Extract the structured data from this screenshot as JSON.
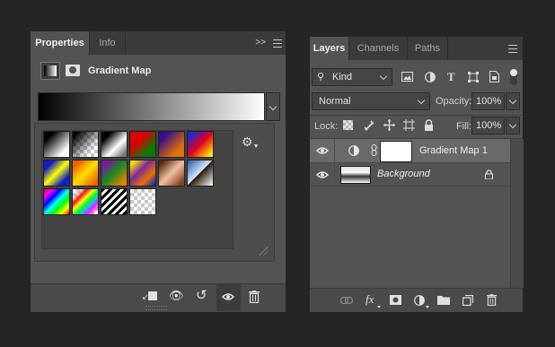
{
  "properties": {
    "tabs": [
      {
        "label": "Properties"
      },
      {
        "label": "Info"
      }
    ],
    "expand_label": ">>",
    "title": "Gradient Map",
    "icons": [
      "adjustment-layer-icon",
      "layer-mask-icon",
      "gear-icon",
      "clip-to-layer-icon",
      "view-previous-state-icon",
      "reset-icon",
      "visibility-icon",
      "trash-icon"
    ],
    "preset_gradients": [
      "black-white",
      "black-transparent",
      "black-white-2",
      "red-green",
      "violet-orange",
      "blue-red-yellow",
      "blue-yellow-blue",
      "orange-yellow-orange",
      "violet-green-orange",
      "yellow-violet-orange-blue",
      "copper",
      "chrome",
      "spectrum",
      "transparent-rainbow",
      "transparent-stripes",
      "checker"
    ]
  },
  "layers": {
    "tabs": [
      {
        "label": "Layers"
      },
      {
        "label": "Channels"
      },
      {
        "label": "Paths"
      }
    ],
    "filter": {
      "kind_label": "Kind"
    },
    "blend_mode": "Normal",
    "opacity_label": "Opacity:",
    "opacity_value": "100%",
    "lock_label": "Lock:",
    "fill_label": "Fill:",
    "fill_value": "100%",
    "items": [
      {
        "name": "Gradient Map 1",
        "selected": true
      },
      {
        "name": "Background",
        "selected": false
      }
    ],
    "footer_icons": [
      "link-icon",
      "fx-icon",
      "mask-icon",
      "adjustment-icon",
      "folder-icon",
      "new-layer-icon",
      "trash-icon"
    ],
    "fx_label": "fx"
  },
  "colors": {
    "panel": "#535353",
    "selected_row": "#696969",
    "dark_bg": "#252525",
    "tab_bar": "#3b3b3b"
  }
}
